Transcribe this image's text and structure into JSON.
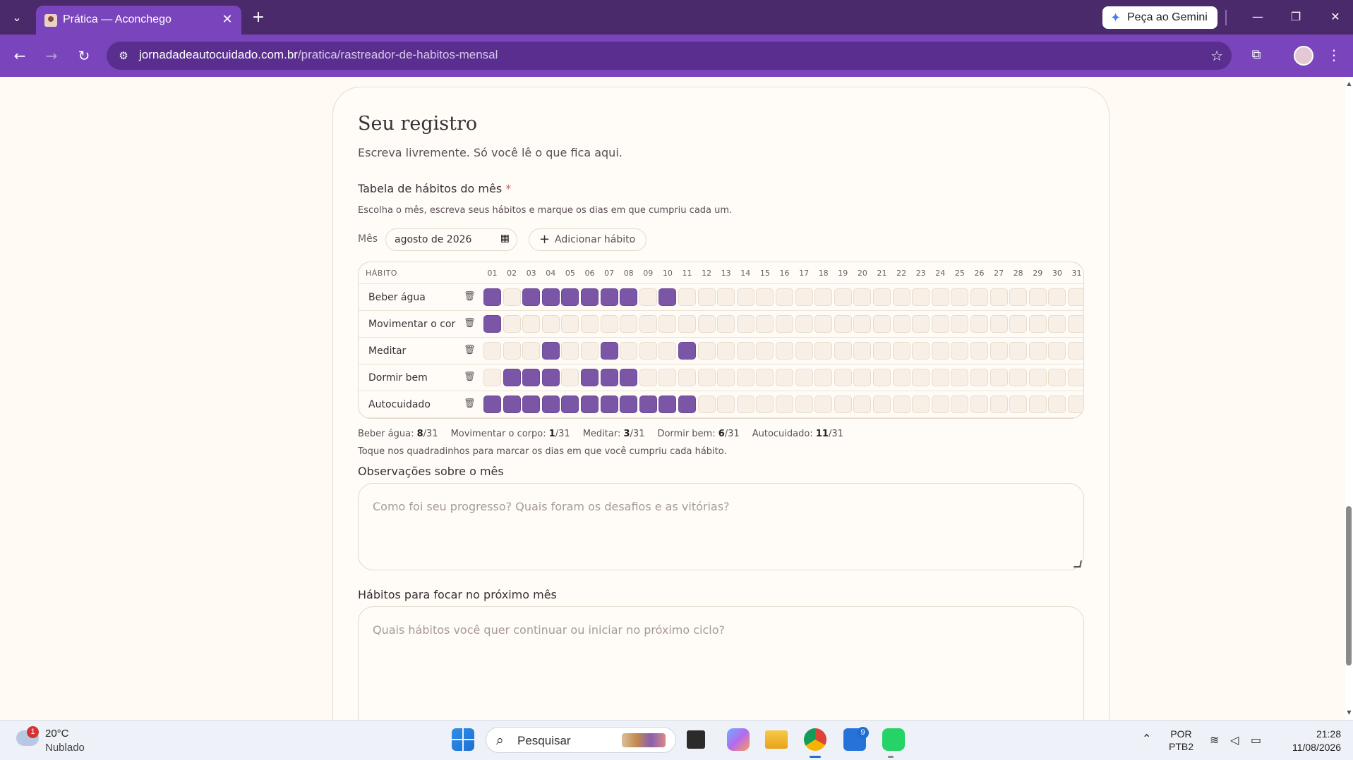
{
  "browser": {
    "tab_title": "Prática — Aconchego",
    "gemini_label": "Peça ao Gemini",
    "url_domain": "jornadadeautocuidado.com.br",
    "url_path": "/pratica/rastreador-de-habitos-mensal"
  },
  "form": {
    "title": "Seu registro",
    "subtitle": "Escreva livremente. Só você lê o que fica aqui.",
    "table_label": "Tabela de hábitos do mês",
    "required_mark": "*",
    "table_hint": "Escolha o mês, escreva seus hábitos e marque os dias em que cumpriu cada um.",
    "month_label": "Mês",
    "month_value": "agosto de 2026",
    "add_habit_label": "Adicionar hábito",
    "habit_col_header": "HÁBITO",
    "days": [
      "01",
      "02",
      "03",
      "04",
      "05",
      "06",
      "07",
      "08",
      "09",
      "10",
      "11",
      "12",
      "13",
      "14",
      "15",
      "16",
      "17",
      "18",
      "19",
      "20",
      "21",
      "22",
      "23",
      "24",
      "25",
      "26",
      "27",
      "28",
      "29",
      "30",
      "31"
    ],
    "habits": [
      {
        "name": "Beber água",
        "done_days": [
          1,
          3,
          4,
          5,
          6,
          7,
          8,
          10
        ]
      },
      {
        "name": "Movimentar o corpo",
        "done_days": [
          1
        ]
      },
      {
        "name": "Meditar",
        "done_days": [
          4,
          7,
          11
        ]
      },
      {
        "name": "Dormir bem",
        "done_days": [
          2,
          3,
          4,
          6,
          7,
          8
        ]
      },
      {
        "name": "Autocuidado",
        "done_days": [
          1,
          2,
          3,
          4,
          5,
          6,
          7,
          8,
          9,
          10,
          11
        ]
      }
    ],
    "stats": [
      {
        "label": "Beber água:",
        "count": "8",
        "total": "/31"
      },
      {
        "label": "Movimentar o corpo:",
        "count": "1",
        "total": "/31"
      },
      {
        "label": "Meditar:",
        "count": "3",
        "total": "/31"
      },
      {
        "label": "Dormir bem:",
        "count": "6",
        "total": "/31"
      },
      {
        "label": "Autocuidado:",
        "count": "11",
        "total": "/31"
      }
    ],
    "tap_hint": "Toque nos quadradinhos para marcar os dias em que você cumpriu cada hábito.",
    "notes_label": "Observações sobre o mês",
    "notes_placeholder": "Como foi seu progresso? Quais foram os desafios e as vitórias?",
    "next_label": "Hábitos para focar no próximo mês",
    "next_placeholder": "Quais hábitos você quer continuar ou iniciar no próximo ciclo?"
  },
  "taskbar": {
    "weather_temp": "20°C",
    "weather_desc": "Nublado",
    "weather_badge": "1",
    "search_label": "Pesquisar",
    "store_badge": "9",
    "lang_top": "POR",
    "lang_bottom": "PTB2",
    "time": "21:28",
    "date": "11/08/2026"
  },
  "colors": {
    "accent": "#7b55a6",
    "chrome_frame": "#4a2a6a",
    "chrome_toolbar": "#7a44bd",
    "page_bg": "#fffaf3"
  }
}
